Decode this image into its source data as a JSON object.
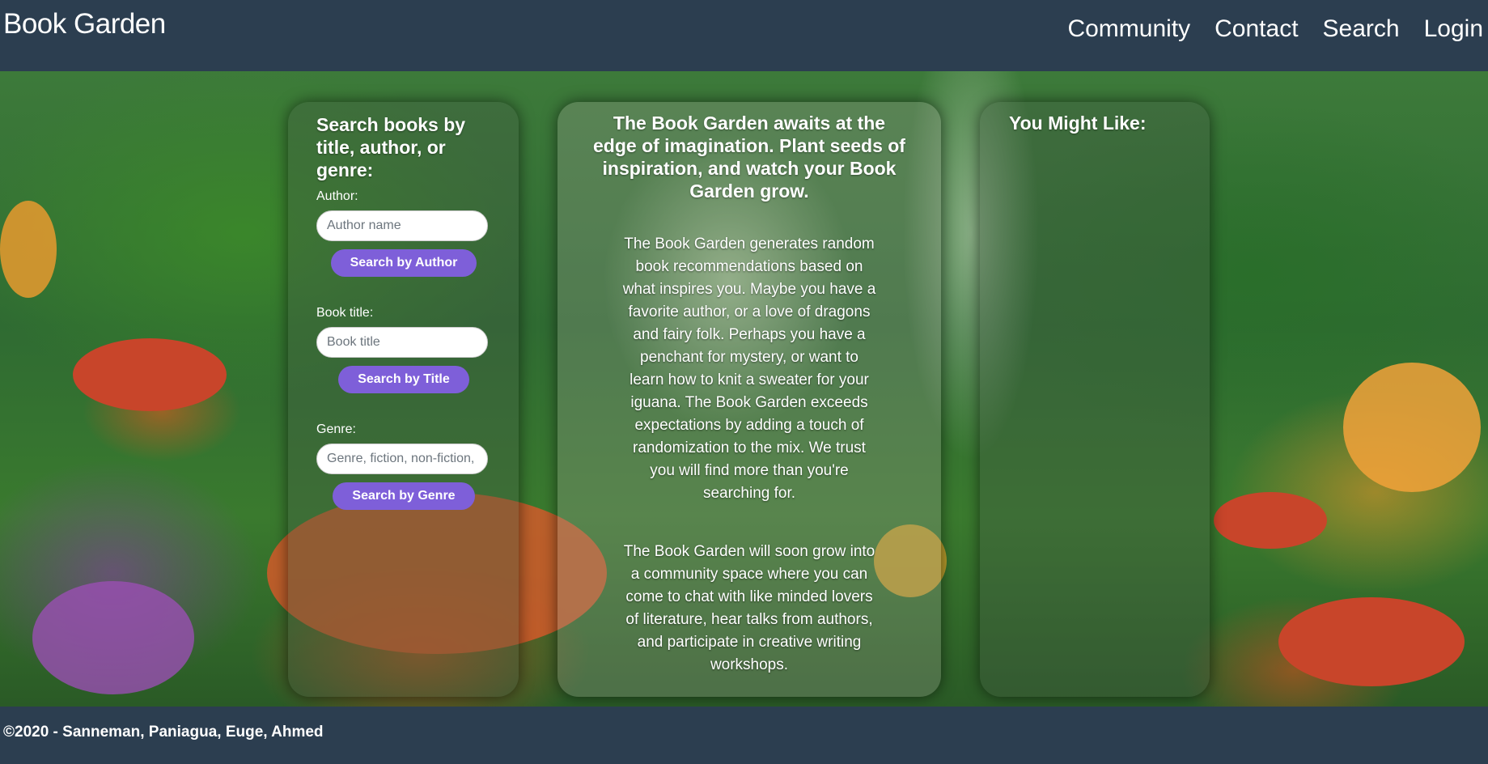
{
  "brand": "Book Garden",
  "nav": [
    "Community",
    "Contact",
    "Search",
    "Login"
  ],
  "search_panel": {
    "heading": "Search books by title, author, or genre:",
    "author": {
      "label": "Author:",
      "placeholder": "Author name",
      "button": "Search by Author"
    },
    "title": {
      "label": "Book title:",
      "placeholder": "Book title",
      "button": "Search by Title"
    },
    "genre": {
      "label": "Genre:",
      "placeholder": "Genre, fiction, non-fiction, etc.",
      "button": "Search by Genre"
    }
  },
  "intro_panel": {
    "heading": "The Book Garden awaits at the edge of imagination. Plant seeds of inspiration, and watch your Book Garden grow.",
    "paragraph1": "The Book Garden generates random book recommendations based on what inspires you. Maybe you have a favorite author, or a love of dragons and fairy folk. Perhaps you have a penchant for mystery, or want to learn how to knit a sweater for your iguana. The Book Garden exceeds expectations by adding a touch of randomization to the mix. We trust you will find more than you're searching for.",
    "paragraph2": "The Book Garden will soon grow into a community space where you can come to chat with like minded lovers of literature, hear talks from authors, and participate in creative writing workshops."
  },
  "recommend_panel": {
    "heading": "You Might Like:"
  },
  "footer": "©2020 - Sanneman, Paniagua, Euge, Ahmed",
  "colors": {
    "navbar": "#2c3e50",
    "button": "#7e5fd9"
  }
}
